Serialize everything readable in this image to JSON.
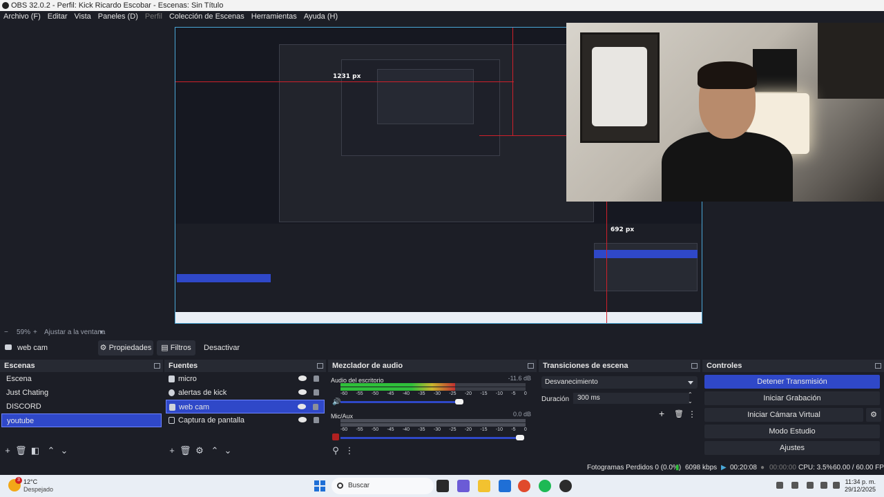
{
  "window": {
    "title": "OBS 32.0.2 - Perfil: Kick Ricardo Escobar - Escenas: Sin Título"
  },
  "menu": [
    "Archivo (F)",
    "Editar",
    "Vista",
    "Paneles (D)",
    "Perfil",
    "Colección de Escenas",
    "Herramientas",
    "Ayuda (H)"
  ],
  "preview": {
    "label_width": "1231 px",
    "label_height": "692 px"
  },
  "zoom": {
    "minus": "−",
    "value": "59%",
    "plus": "+",
    "fit": "Ajustar a la ventana"
  },
  "source_toolbar": {
    "name": "web cam",
    "properties": "Propiedades",
    "filters": "Filtros",
    "deactivate": "Desactivar"
  },
  "scenes": {
    "title": "Escenas",
    "items": [
      "Escena",
      "Just Chating",
      "DISCORD",
      "youtube"
    ],
    "selected": "youtube"
  },
  "sources": {
    "title": "Fuentes",
    "items": [
      {
        "label": "micro",
        "icon": "microphone-icon"
      },
      {
        "label": "alertas de kick",
        "icon": "globe-icon"
      },
      {
        "label": "web cam",
        "icon": "camera-icon"
      },
      {
        "label": "Captura de pantalla",
        "icon": "monitor-icon"
      }
    ],
    "selected": "web cam"
  },
  "mixer": {
    "title": "Mezclador de audio",
    "channels": [
      {
        "name": "Audio del escritorio",
        "db": "-11.6 dB",
        "level": 0.62
      },
      {
        "name": "Mic/Aux",
        "db": "0.0 dB",
        "level": 0.0
      }
    ],
    "scale": [
      "-60",
      "-55",
      "-50",
      "-45",
      "-40",
      "-35",
      "-30",
      "-25",
      "-20",
      "-15",
      "-10",
      "-5",
      "0"
    ]
  },
  "transitions": {
    "title": "Transiciones de escena",
    "selected": "Desvanecimiento",
    "duration_label": "Duración",
    "duration_value": "300 ms"
  },
  "controls": {
    "title": "Controles",
    "buttons": [
      "Detener Transmisión",
      "Iniciar Grabación",
      "Iniciar Cámara Virtual",
      "Modo Estudio",
      "Ajustes"
    ],
    "active": "Detener Transmisión"
  },
  "status": {
    "dropped": "Fotogramas Perdidos 0 (0.0%)",
    "bitrate": "6098 kbps",
    "stream_time": "00:20:08",
    "rec_time": "00:00:00",
    "cpu": "CPU: 3.5%",
    "fps": "60.00 / 60.00 FPS"
  },
  "taskbar": {
    "weather_temp": "12°C",
    "weather_desc": "Despejado",
    "notification_count": "3",
    "search": "Buscar",
    "time": "11:34 p. m.",
    "date": "29/12/2025"
  },
  "colors": {
    "accent": "#2f48c8",
    "background": "#1c1e26",
    "panel_header": "#272a33",
    "red_guide": "#d0202a"
  }
}
